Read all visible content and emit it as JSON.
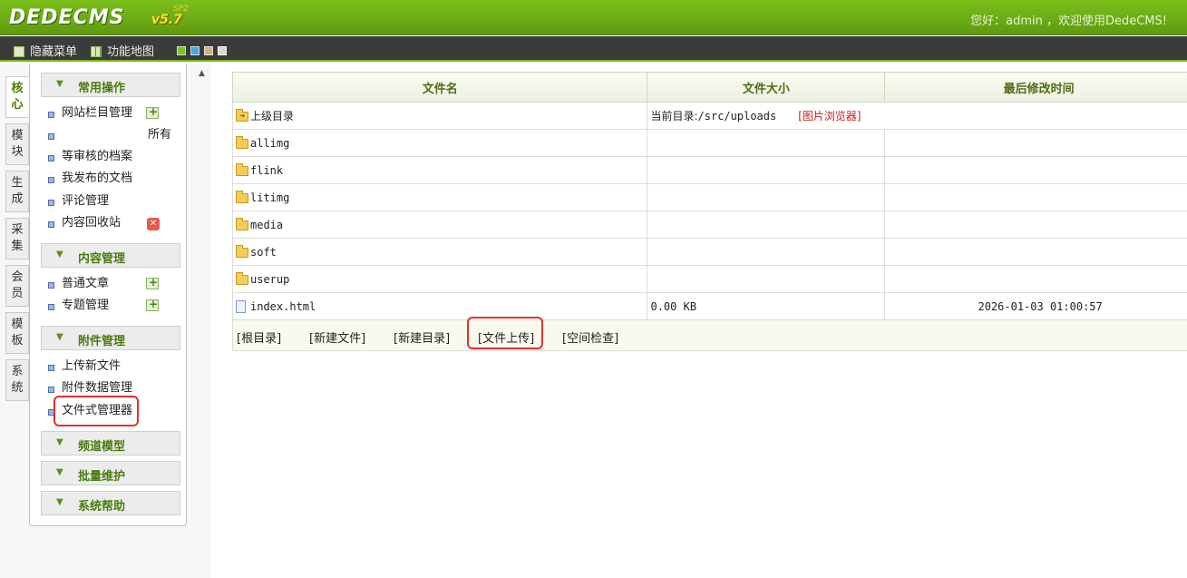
{
  "header": {
    "logo_text": "DEDECMS",
    "logo_version": "v5.7",
    "logo_edition": "SP2",
    "welcome": "您好：admin ，欢迎使用DedeCMS!"
  },
  "toolbar": {
    "hide_menu": "隐藏菜单",
    "function_map": "功能地图",
    "skin_colors": [
      "#7cc02a",
      "#4ea6d6",
      "#c6b58d",
      "#d8d8d8"
    ]
  },
  "side_tabs": [
    {
      "label": "核心",
      "active": true
    },
    {
      "label": "模块"
    },
    {
      "label": "生成"
    },
    {
      "label": "采集"
    },
    {
      "label": "会员"
    },
    {
      "label": "模板"
    },
    {
      "label": "系统"
    }
  ],
  "menu": {
    "sections": {
      "common": "常用操作",
      "content": "内容管理",
      "attachment": "附件管理",
      "channel": "频道模型",
      "batch": "批量维护",
      "help": "系统帮助"
    },
    "common_items": {
      "columns": "网站栏目管理",
      "all": "所有",
      "pending": "等审核的档案",
      "mine": "我发布的文档",
      "comments": "评论管理",
      "recycle": "内容回收站"
    },
    "content_items": {
      "article": "普通文章",
      "topic": "专题管理"
    },
    "attachment_items": {
      "upload": "上传新文件",
      "data": "附件数据管理",
      "filemanager": "文件式管理器"
    }
  },
  "file_table": {
    "headers": [
      "文件名",
      "文件大小",
      "最后修改时间"
    ],
    "parent": {
      "name": "上级目录",
      "current_dir_label": "当前目录:",
      "current_dir": "/src/uploads",
      "image_browser": "[图片浏览器]"
    },
    "folders": [
      "allimg",
      "flink",
      "litimg",
      "media",
      "soft",
      "userup"
    ],
    "files": [
      {
        "name": "index.html",
        "size": "0.00 KB",
        "mtime": "2026-01-03 01:00:57"
      }
    ],
    "actions": {
      "root": "[根目录]",
      "new_file": "[新建文件]",
      "new_dir": "[新建目录]",
      "upload": "[文件上传]",
      "space_check": "[空间检查]"
    }
  }
}
